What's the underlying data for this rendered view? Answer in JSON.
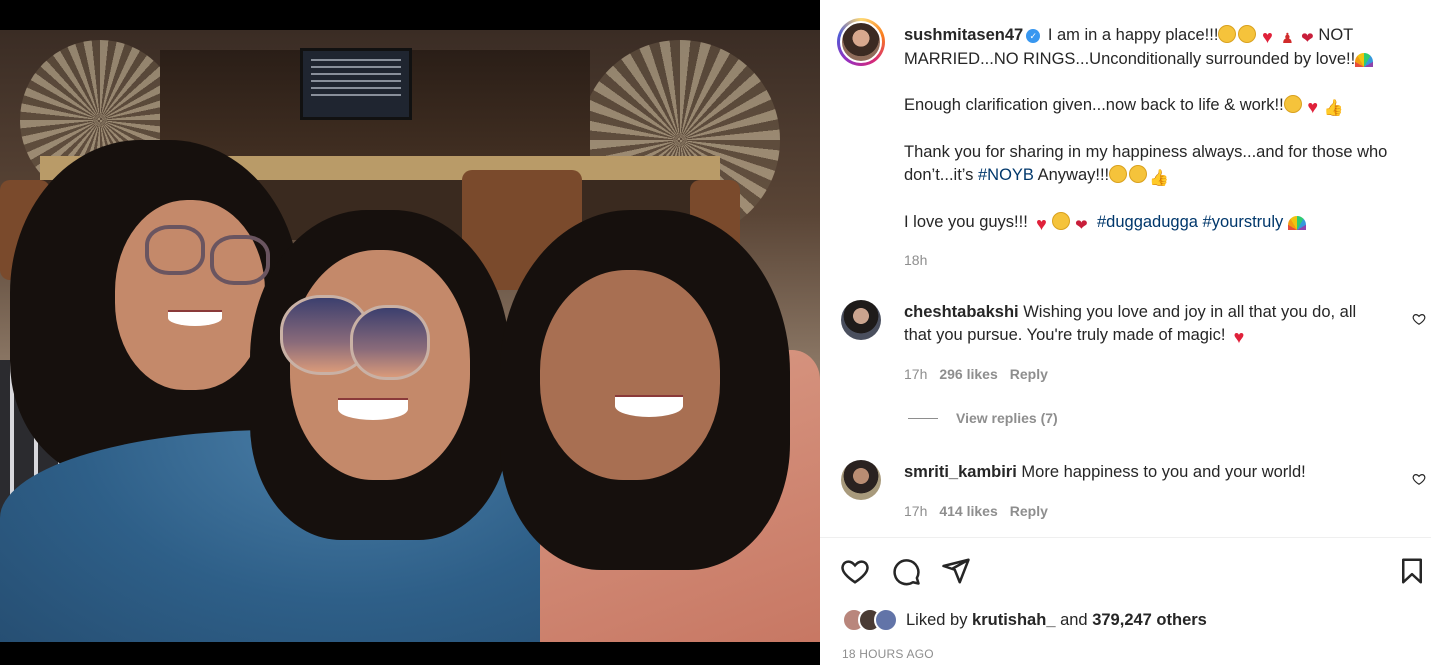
{
  "post": {
    "username": "sushmitasen47",
    "verified_icon": "verified-badge-icon",
    "caption_line1": " I am in a happy place!!!",
    "caption_line1b": "NOT MARRIED...NO RINGS...Unconditionally surrounded by love!!",
    "caption_line2": "Enough clarification given...now back to life & work!!",
    "caption_line3a": "Thank you for sharing in my happiness always...and for those who don’t...it’s ",
    "caption_hashtag_noyb": "#NOYB",
    "caption_line3b": " Anyway!!!",
    "caption_line4": "I love you guys!!! ",
    "hashtag_1": "#duggadugga",
    "hashtag_2": "#yourstruly",
    "caption_time": "18h"
  },
  "comments": [
    {
      "username": "cheshtabakshi",
      "text": " Wishing you love and joy in all that you do, all that you pursue. You're truly made of magic! ",
      "time": "17h",
      "likes": "296 likes",
      "reply_label": "Reply",
      "view_replies": "View replies (7)"
    },
    {
      "username": "smriti_kambiri",
      "text": " More happiness to you and your world!",
      "time": "17h",
      "likes": "414 likes",
      "reply_label": "Reply"
    }
  ],
  "liked_by": {
    "prefix": "Liked by ",
    "user": "krutishah_",
    "middle": " and ",
    "others": "379,247 others"
  },
  "posted_ago": "18 HOURS AGO",
  "colors": {
    "hashtag": "#00376b",
    "verified": "#3897f0",
    "meta_gray": "#8e8e8e",
    "heart_red": "#e0213a"
  }
}
